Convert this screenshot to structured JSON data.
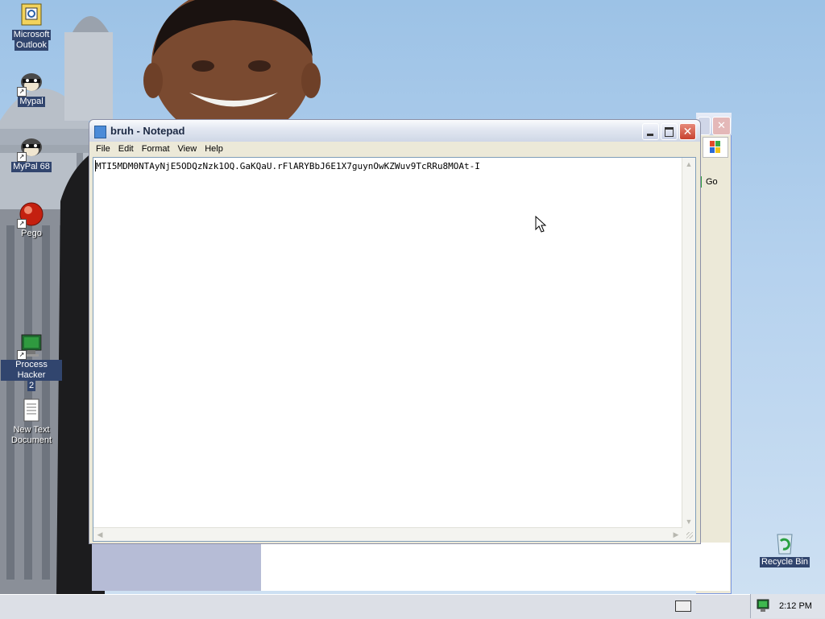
{
  "desktop": {
    "icons": [
      {
        "label": "Microsoft Outlook",
        "line1": "Microsoft",
        "line2": "Outlook"
      },
      {
        "label": "Mypal",
        "line1": "Mypal",
        "line2": ""
      },
      {
        "label": "MyPal 68",
        "line1": "MyPal 68",
        "line2": ""
      },
      {
        "label": "Pego",
        "line1": "Pego",
        "line2": ""
      },
      {
        "label": "Process Hacker 2",
        "line1": "Process Hacker",
        "line2": "2"
      },
      {
        "label": "New Text Document",
        "line1": "New Text",
        "line2": "Document"
      },
      {
        "label": "Recycle Bin",
        "line1": "Recycle Bin",
        "line2": ""
      }
    ]
  },
  "background_window": {
    "go_label": "Go"
  },
  "notepad": {
    "title": "bruh - Notepad",
    "menu": [
      "File",
      "Edit",
      "Format",
      "View",
      "Help"
    ],
    "content": "MTI5MDM0NTAyNjE5ODQzNzk1OQ.GaKQaU.rFlARYBbJ6E1X7guynOwKZWuv9TcRRu8MOAt-I"
  },
  "taskbar": {
    "clock": "2:12 PM"
  },
  "colors": {
    "sky": "#b6d2ee",
    "selected_label_bg": "#31456e",
    "close_button": "#c8412f"
  }
}
